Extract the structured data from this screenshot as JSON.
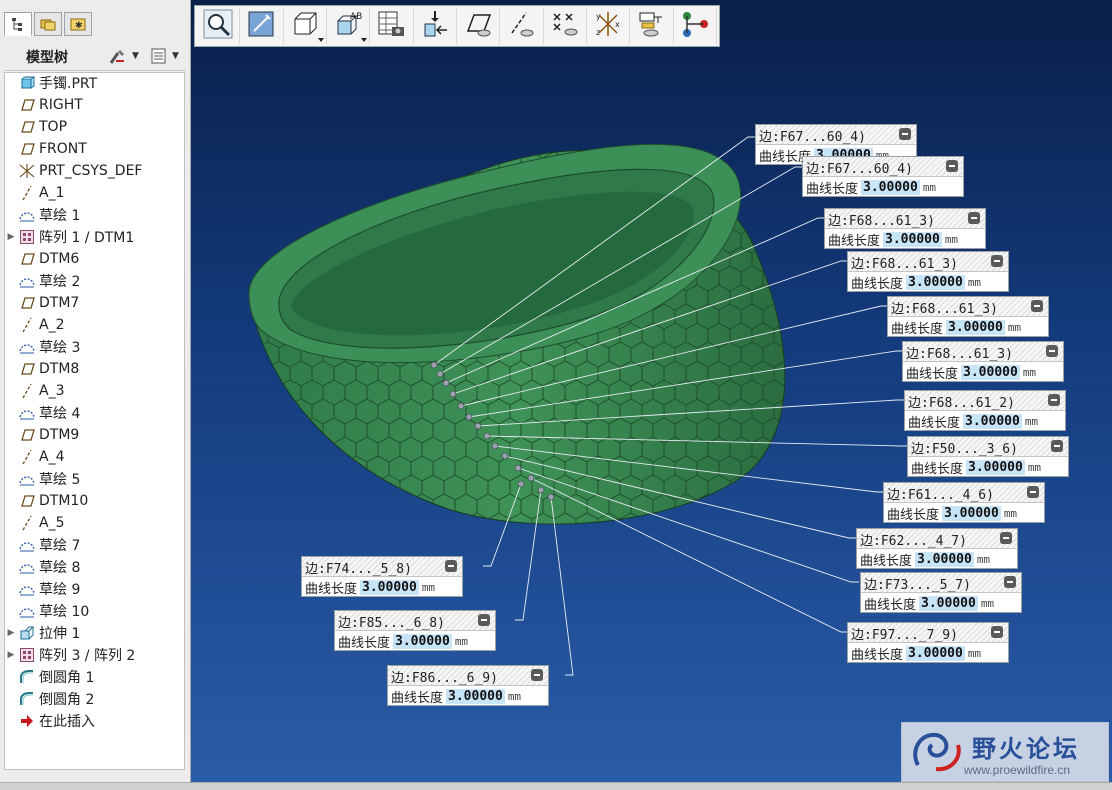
{
  "left_panel": {
    "tree_title": "模型树",
    "items": [
      {
        "label": "手镯.PRT",
        "icon": "part-icon",
        "expandable": false
      },
      {
        "label": "RIGHT",
        "icon": "datum-plane-icon",
        "expandable": false
      },
      {
        "label": "TOP",
        "icon": "datum-plane-icon",
        "expandable": false
      },
      {
        "label": "FRONT",
        "icon": "datum-plane-icon",
        "expandable": false
      },
      {
        "label": "PRT_CSYS_DEF",
        "icon": "csys-icon",
        "expandable": false
      },
      {
        "label": "A_1",
        "icon": "datum-axis-icon",
        "expandable": false
      },
      {
        "label": "草绘 1",
        "icon": "sketch-icon",
        "expandable": false
      },
      {
        "label": "阵列 1 / DTM1",
        "icon": "pattern-icon",
        "expandable": true
      },
      {
        "label": "DTM6",
        "icon": "datum-plane-icon",
        "expandable": false
      },
      {
        "label": "草绘 2",
        "icon": "sketch-icon",
        "expandable": false
      },
      {
        "label": "DTM7",
        "icon": "datum-plane-icon",
        "expandable": false
      },
      {
        "label": "A_2",
        "icon": "datum-axis-icon",
        "expandable": false
      },
      {
        "label": "草绘 3",
        "icon": "sketch-icon",
        "expandable": false
      },
      {
        "label": "DTM8",
        "icon": "datum-plane-icon",
        "expandable": false
      },
      {
        "label": "A_3",
        "icon": "datum-axis-icon",
        "expandable": false
      },
      {
        "label": "草绘 4",
        "icon": "sketch-icon",
        "expandable": false
      },
      {
        "label": "DTM9",
        "icon": "datum-plane-icon",
        "expandable": false
      },
      {
        "label": "A_4",
        "icon": "datum-axis-icon",
        "expandable": false
      },
      {
        "label": "草绘 5",
        "icon": "sketch-icon",
        "expandable": false
      },
      {
        "label": "DTM10",
        "icon": "datum-plane-icon",
        "expandable": false
      },
      {
        "label": "A_5",
        "icon": "datum-axis-icon",
        "expandable": false
      },
      {
        "label": "草绘 7",
        "icon": "sketch-icon",
        "expandable": false
      },
      {
        "label": "草绘 8",
        "icon": "sketch-icon",
        "expandable": false
      },
      {
        "label": "草绘 9",
        "icon": "sketch-icon",
        "expandable": false
      },
      {
        "label": "草绘 10",
        "icon": "sketch-icon",
        "expandable": false
      },
      {
        "label": "拉伸 1",
        "icon": "extrude-icon",
        "expandable": true
      },
      {
        "label": "阵列 3 / 阵列 2",
        "icon": "pattern-icon",
        "expandable": true
      },
      {
        "label": "倒圆角 1",
        "icon": "round-icon",
        "expandable": false
      },
      {
        "label": "倒圆角 2",
        "icon": "round-icon",
        "expandable": false
      },
      {
        "label": "在此插入",
        "icon": "insert-here-icon",
        "expandable": false
      }
    ]
  },
  "toolbar": {
    "buttons": [
      {
        "name": "zoom-icon",
        "dropdown": false
      },
      {
        "name": "repaint-icon",
        "dropdown": false
      },
      {
        "name": "display-style-icon",
        "dropdown": true
      },
      {
        "name": "saved-views-icon",
        "dropdown": true
      },
      {
        "name": "table-capture-icon",
        "dropdown": false
      },
      {
        "name": "insert-feature-icon",
        "dropdown": false
      },
      {
        "name": "plane-display-icon",
        "dropdown": false
      },
      {
        "name": "axis-display-icon",
        "dropdown": false
      },
      {
        "name": "point-display-icon",
        "dropdown": false
      },
      {
        "name": "csys-display-icon",
        "dropdown": false
      },
      {
        "name": "annotation-display-icon",
        "dropdown": false
      },
      {
        "name": "connect-icon",
        "dropdown": false
      }
    ]
  },
  "callouts": [
    {
      "title": "边:F67...60_4)",
      "label": "曲线长度",
      "value": "3.00000",
      "unit": "mm"
    },
    {
      "title": "边:F67...60_4)",
      "label": "曲线长度",
      "value": "3.00000",
      "unit": "mm"
    },
    {
      "title": "边:F68...61_3)",
      "label": "曲线长度",
      "value": "3.00000",
      "unit": "mm"
    },
    {
      "title": "边:F68...61_3)",
      "label": "曲线长度",
      "value": "3.00000",
      "unit": "mm"
    },
    {
      "title": "边:F68...61_3)",
      "label": "曲线长度",
      "value": "3.00000",
      "unit": "mm"
    },
    {
      "title": "边:F68...61_3)",
      "label": "曲线长度",
      "value": "3.00000",
      "unit": "mm"
    },
    {
      "title": "边:F68...61_2)",
      "label": "曲线长度",
      "value": "3.00000",
      "unit": "mm"
    },
    {
      "title": "边:F50..._3_6)",
      "label": "曲线长度",
      "value": "3.00000",
      "unit": "mm"
    },
    {
      "title": "边:F61..._4_6)",
      "label": "曲线长度",
      "value": "3.00000",
      "unit": "mm"
    },
    {
      "title": "边:F62..._4_7)",
      "label": "曲线长度",
      "value": "3.00000",
      "unit": "mm"
    },
    {
      "title": "边:F73..._5_7)",
      "label": "曲线长度",
      "value": "3.00000",
      "unit": "mm"
    },
    {
      "title": "边:F97..._7_9)",
      "label": "曲线长度",
      "value": "3.00000",
      "unit": "mm"
    },
    {
      "title": "边:F74..._5_8)",
      "label": "曲线长度",
      "value": "3.00000",
      "unit": "mm"
    },
    {
      "title": "边:F85..._6_8)",
      "label": "曲线长度",
      "value": "3.00000",
      "unit": "mm"
    },
    {
      "title": "边:F86..._6_9)",
      "label": "曲线长度",
      "value": "3.00000",
      "unit": "mm"
    }
  ],
  "watermark": {
    "title": "野火论坛",
    "url": "www.proewildfire.cn"
  },
  "colors": {
    "model_green": "#3a8a55",
    "viewport_bg_top": "#0a1f4a",
    "viewport_bg_bottom": "#2a5ca8",
    "value_highlight": "#c7e3f6"
  }
}
